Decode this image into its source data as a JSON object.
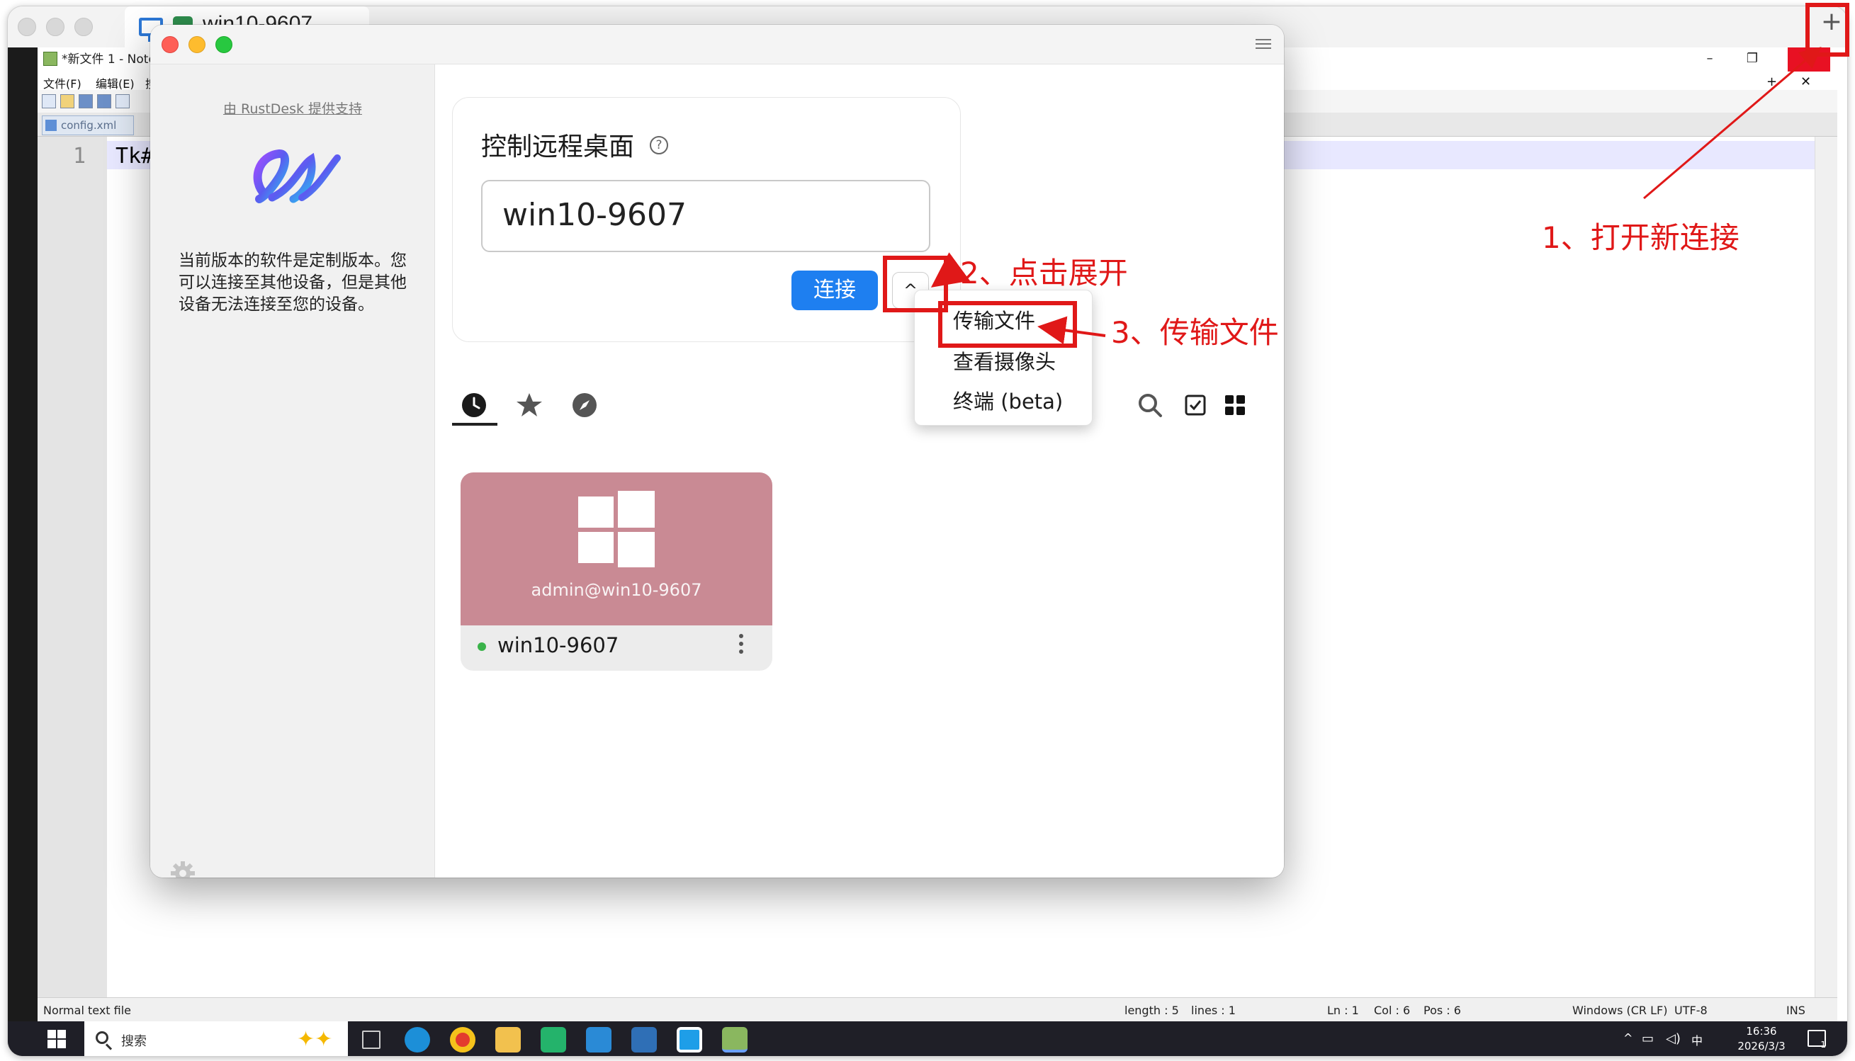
{
  "outer_window": {
    "tab_title": "win10-9607",
    "new_tab_symbol": "+"
  },
  "notepad": {
    "title": "*新文件 1 - Notep",
    "menus": [
      "文件(F)",
      "编辑(E)",
      "搜"
    ],
    "tab_label": "config.xml",
    "line_number": "1",
    "code_text": "Tk#",
    "status": {
      "file_type": "Normal text file",
      "length": "length : 5",
      "lines": "lines : 1",
      "ln": "Ln : 1",
      "col": "Col : 6",
      "pos": "Pos : 6",
      "eol": "Windows (CR LF)",
      "encoding": "UTF-8",
      "mode": "INS"
    }
  },
  "taskbar": {
    "search_placeholder": "搜索",
    "ime": "中",
    "time": "16:36",
    "date": "2026/3/3",
    "notification_count": "1"
  },
  "rustdesk": {
    "powered_by": "由 RustDesk 提供支持",
    "notice": "当前版本的软件是定制版本。您可以连接至其他设备，但是其他设备无法连接至您的设备。",
    "control_title": "控制远程桌面",
    "id_input_value": "win10-9607",
    "connect_label": "连接",
    "expand_symbol": "^",
    "dropdown": {
      "items": [
        "传输文件",
        "查看摄像头",
        "终端 (beta)"
      ]
    },
    "peer": {
      "user_at_host": "admin@win10-9607",
      "name": "win10-9607",
      "online_color": "#3ab34a",
      "thumb_color": "#c98a94"
    }
  },
  "annotations": {
    "step1": "1、打开新连接",
    "step2": "2、点击展开",
    "step3": "3、传输文件",
    "color": "#e01818"
  }
}
